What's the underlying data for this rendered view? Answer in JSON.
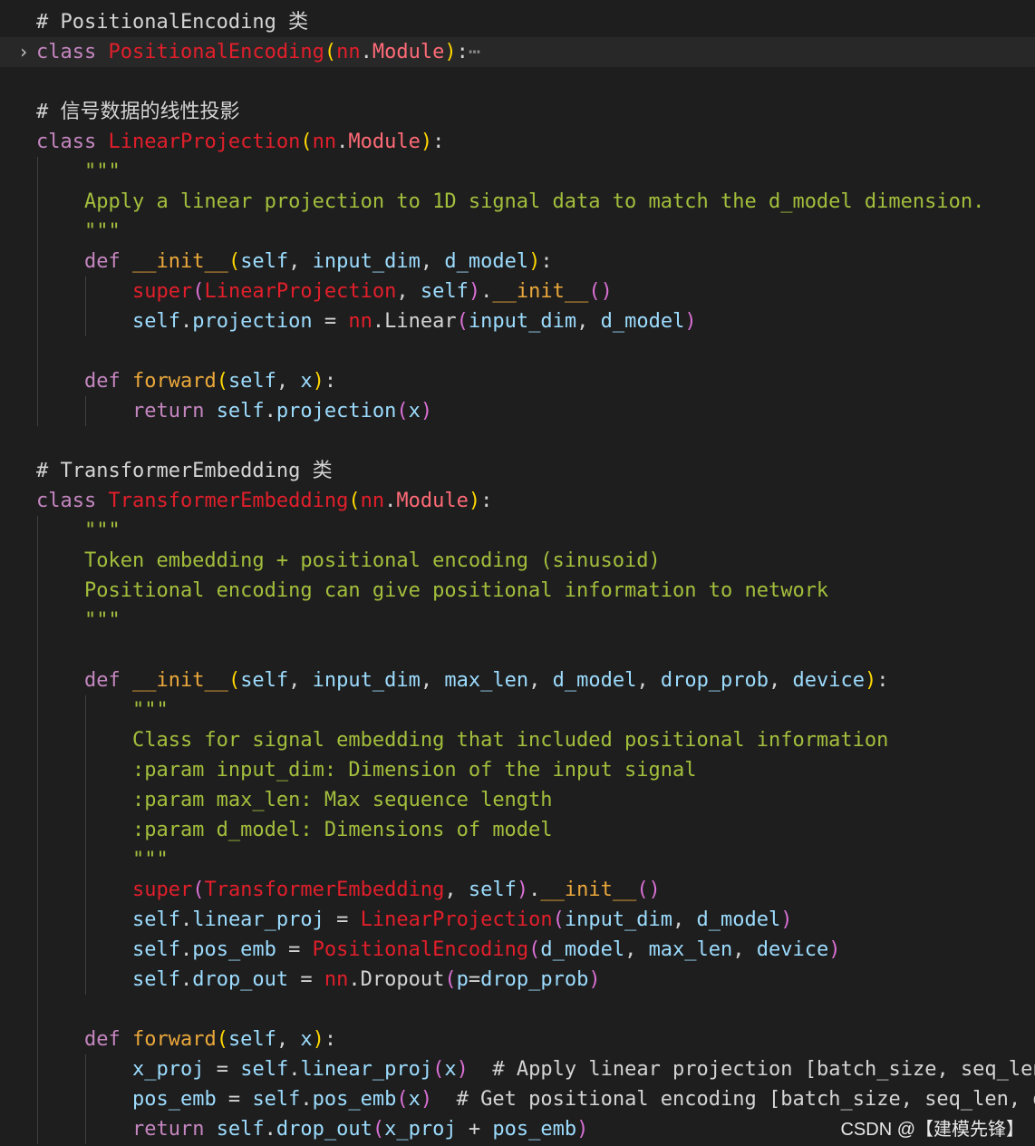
{
  "lines": [
    {
      "current": false,
      "fold": "",
      "tokens": [
        {
          "t": "# PositionalEncoding 类",
          "c": "cm"
        }
      ]
    },
    {
      "current": true,
      "fold": "›",
      "tokens": [
        {
          "t": "class ",
          "c": "kw"
        },
        {
          "t": "PositionalEncoding",
          "c": "cls"
        },
        {
          "t": "(",
          "c": "p0"
        },
        {
          "t": "nn",
          "c": "mod"
        },
        {
          "t": ".",
          "c": "plain"
        },
        {
          "t": "Module",
          "c": "modclass"
        },
        {
          "t": ")",
          "c": "p0"
        },
        {
          "t": ":",
          "c": "plain"
        },
        {
          "t": "⋯",
          "c": "dim"
        }
      ]
    },
    {
      "current": false,
      "fold": "",
      "tokens": []
    },
    {
      "current": false,
      "fold": "",
      "tokens": [
        {
          "t": "# 信号数据的线性投影",
          "c": "cm"
        }
      ]
    },
    {
      "current": false,
      "fold": "",
      "tokens": [
        {
          "t": "class ",
          "c": "kw"
        },
        {
          "t": "LinearProjection",
          "c": "cls"
        },
        {
          "t": "(",
          "c": "p0"
        },
        {
          "t": "nn",
          "c": "mod"
        },
        {
          "t": ".",
          "c": "plain"
        },
        {
          "t": "Module",
          "c": "modclass"
        },
        {
          "t": ")",
          "c": "p0"
        },
        {
          "t": ":",
          "c": "plain"
        }
      ]
    },
    {
      "current": false,
      "fold": "",
      "tokens": [
        {
          "t": "    \"\"\"",
          "c": "doc"
        }
      ]
    },
    {
      "current": false,
      "fold": "",
      "tokens": [
        {
          "t": "    Apply a linear projection to 1D signal data to match the d_model dimension.",
          "c": "doc"
        }
      ]
    },
    {
      "current": false,
      "fold": "",
      "tokens": [
        {
          "t": "    \"\"\"",
          "c": "doc"
        }
      ]
    },
    {
      "current": false,
      "fold": "",
      "tokens": [
        {
          "t": "    ",
          "c": "plain"
        },
        {
          "t": "def ",
          "c": "kw"
        },
        {
          "t": "__init__",
          "c": "fn"
        },
        {
          "t": "(",
          "c": "p0"
        },
        {
          "t": "self",
          "c": "self"
        },
        {
          "t": ", ",
          "c": "plain"
        },
        {
          "t": "input_dim",
          "c": "attr"
        },
        {
          "t": ", ",
          "c": "plain"
        },
        {
          "t": "d_model",
          "c": "attr"
        },
        {
          "t": ")",
          "c": "p0"
        },
        {
          "t": ":",
          "c": "plain"
        }
      ]
    },
    {
      "current": false,
      "fold": "",
      "tokens": [
        {
          "t": "        ",
          "c": "plain"
        },
        {
          "t": "super",
          "c": "cls"
        },
        {
          "t": "(",
          "c": "p1"
        },
        {
          "t": "LinearProjection",
          "c": "cls"
        },
        {
          "t": ", ",
          "c": "plain"
        },
        {
          "t": "self",
          "c": "self"
        },
        {
          "t": ")",
          "c": "p1"
        },
        {
          "t": ".",
          "c": "plain"
        },
        {
          "t": "__init__",
          "c": "fn"
        },
        {
          "t": "()",
          "c": "p1"
        }
      ]
    },
    {
      "current": false,
      "fold": "",
      "tokens": [
        {
          "t": "        ",
          "c": "plain"
        },
        {
          "t": "self",
          "c": "self"
        },
        {
          "t": ".",
          "c": "plain"
        },
        {
          "t": "projection",
          "c": "attr"
        },
        {
          "t": " = ",
          "c": "op"
        },
        {
          "t": "nn",
          "c": "mod"
        },
        {
          "t": ".",
          "c": "plain"
        },
        {
          "t": "Linear",
          "c": "plain"
        },
        {
          "t": "(",
          "c": "p1"
        },
        {
          "t": "input_dim",
          "c": "attr"
        },
        {
          "t": ", ",
          "c": "plain"
        },
        {
          "t": "d_model",
          "c": "attr"
        },
        {
          "t": ")",
          "c": "p1"
        }
      ]
    },
    {
      "current": false,
      "fold": "",
      "tokens": []
    },
    {
      "current": false,
      "fold": "",
      "tokens": [
        {
          "t": "    ",
          "c": "plain"
        },
        {
          "t": "def ",
          "c": "kw"
        },
        {
          "t": "forward",
          "c": "fn"
        },
        {
          "t": "(",
          "c": "p0"
        },
        {
          "t": "self",
          "c": "self"
        },
        {
          "t": ", ",
          "c": "plain"
        },
        {
          "t": "x",
          "c": "attr"
        },
        {
          "t": ")",
          "c": "p0"
        },
        {
          "t": ":",
          "c": "plain"
        }
      ]
    },
    {
      "current": false,
      "fold": "",
      "tokens": [
        {
          "t": "        ",
          "c": "plain"
        },
        {
          "t": "return ",
          "c": "kw"
        },
        {
          "t": "self",
          "c": "self"
        },
        {
          "t": ".",
          "c": "plain"
        },
        {
          "t": "projection",
          "c": "attr"
        },
        {
          "t": "(",
          "c": "p1"
        },
        {
          "t": "x",
          "c": "attr"
        },
        {
          "t": ")",
          "c": "p1"
        }
      ]
    },
    {
      "current": false,
      "fold": "",
      "tokens": []
    },
    {
      "current": false,
      "fold": "",
      "tokens": [
        {
          "t": "# TransformerEmbedding 类",
          "c": "cm"
        }
      ]
    },
    {
      "current": false,
      "fold": "",
      "tokens": [
        {
          "t": "class ",
          "c": "kw"
        },
        {
          "t": "TransformerEmbedding",
          "c": "cls"
        },
        {
          "t": "(",
          "c": "p0"
        },
        {
          "t": "nn",
          "c": "mod"
        },
        {
          "t": ".",
          "c": "plain"
        },
        {
          "t": "Module",
          "c": "modclass"
        },
        {
          "t": ")",
          "c": "p0"
        },
        {
          "t": ":",
          "c": "plain"
        }
      ]
    },
    {
      "current": false,
      "fold": "",
      "tokens": [
        {
          "t": "    \"\"\"",
          "c": "doc"
        }
      ]
    },
    {
      "current": false,
      "fold": "",
      "tokens": [
        {
          "t": "    Token embedding + positional encoding (sinusoid)",
          "c": "doc"
        }
      ]
    },
    {
      "current": false,
      "fold": "",
      "tokens": [
        {
          "t": "    Positional encoding can give positional information to network",
          "c": "doc"
        }
      ]
    },
    {
      "current": false,
      "fold": "",
      "tokens": [
        {
          "t": "    \"\"\"",
          "c": "doc"
        }
      ]
    },
    {
      "current": false,
      "fold": "",
      "tokens": []
    },
    {
      "current": false,
      "fold": "",
      "tokens": [
        {
          "t": "    ",
          "c": "plain"
        },
        {
          "t": "def ",
          "c": "kw"
        },
        {
          "t": "__init__",
          "c": "fn"
        },
        {
          "t": "(",
          "c": "p0"
        },
        {
          "t": "self",
          "c": "self"
        },
        {
          "t": ", ",
          "c": "plain"
        },
        {
          "t": "input_dim",
          "c": "attr"
        },
        {
          "t": ", ",
          "c": "plain"
        },
        {
          "t": "max_len",
          "c": "attr"
        },
        {
          "t": ", ",
          "c": "plain"
        },
        {
          "t": "d_model",
          "c": "attr"
        },
        {
          "t": ", ",
          "c": "plain"
        },
        {
          "t": "drop_prob",
          "c": "attr"
        },
        {
          "t": ", ",
          "c": "plain"
        },
        {
          "t": "device",
          "c": "attr"
        },
        {
          "t": ")",
          "c": "p0"
        },
        {
          "t": ":",
          "c": "plain"
        }
      ]
    },
    {
      "current": false,
      "fold": "",
      "tokens": [
        {
          "t": "        \"\"\"",
          "c": "doc"
        }
      ]
    },
    {
      "current": false,
      "fold": "",
      "tokens": [
        {
          "t": "        Class for signal embedding that included positional information",
          "c": "doc"
        }
      ]
    },
    {
      "current": false,
      "fold": "",
      "tokens": [
        {
          "t": "        :param input_dim: Dimension of the input signal",
          "c": "doc"
        }
      ]
    },
    {
      "current": false,
      "fold": "",
      "tokens": [
        {
          "t": "        :param max_len: Max sequence length",
          "c": "doc"
        }
      ]
    },
    {
      "current": false,
      "fold": "",
      "tokens": [
        {
          "t": "        :param d_model: Dimensions of model",
          "c": "doc"
        }
      ]
    },
    {
      "current": false,
      "fold": "",
      "tokens": [
        {
          "t": "        \"\"\"",
          "c": "doc"
        }
      ]
    },
    {
      "current": false,
      "fold": "",
      "tokens": [
        {
          "t": "        ",
          "c": "plain"
        },
        {
          "t": "super",
          "c": "cls"
        },
        {
          "t": "(",
          "c": "p1"
        },
        {
          "t": "TransformerEmbedding",
          "c": "cls"
        },
        {
          "t": ", ",
          "c": "plain"
        },
        {
          "t": "self",
          "c": "self"
        },
        {
          "t": ")",
          "c": "p1"
        },
        {
          "t": ".",
          "c": "plain"
        },
        {
          "t": "__init__",
          "c": "fn"
        },
        {
          "t": "()",
          "c": "p1"
        }
      ]
    },
    {
      "current": false,
      "fold": "",
      "tokens": [
        {
          "t": "        ",
          "c": "plain"
        },
        {
          "t": "self",
          "c": "self"
        },
        {
          "t": ".",
          "c": "plain"
        },
        {
          "t": "linear_proj",
          "c": "attr"
        },
        {
          "t": " = ",
          "c": "op"
        },
        {
          "t": "LinearProjection",
          "c": "cls"
        },
        {
          "t": "(",
          "c": "p1"
        },
        {
          "t": "input_dim",
          "c": "attr"
        },
        {
          "t": ", ",
          "c": "plain"
        },
        {
          "t": "d_model",
          "c": "attr"
        },
        {
          "t": ")",
          "c": "p1"
        }
      ]
    },
    {
      "current": false,
      "fold": "",
      "tokens": [
        {
          "t": "        ",
          "c": "plain"
        },
        {
          "t": "self",
          "c": "self"
        },
        {
          "t": ".",
          "c": "plain"
        },
        {
          "t": "pos_emb",
          "c": "attr"
        },
        {
          "t": " = ",
          "c": "op"
        },
        {
          "t": "PositionalEncoding",
          "c": "cls"
        },
        {
          "t": "(",
          "c": "p1"
        },
        {
          "t": "d_model",
          "c": "attr"
        },
        {
          "t": ", ",
          "c": "plain"
        },
        {
          "t": "max_len",
          "c": "attr"
        },
        {
          "t": ", ",
          "c": "plain"
        },
        {
          "t": "device",
          "c": "attr"
        },
        {
          "t": ")",
          "c": "p1"
        }
      ]
    },
    {
      "current": false,
      "fold": "",
      "tokens": [
        {
          "t": "        ",
          "c": "plain"
        },
        {
          "t": "self",
          "c": "self"
        },
        {
          "t": ".",
          "c": "plain"
        },
        {
          "t": "drop_out",
          "c": "attr"
        },
        {
          "t": " = ",
          "c": "op"
        },
        {
          "t": "nn",
          "c": "mod"
        },
        {
          "t": ".",
          "c": "plain"
        },
        {
          "t": "Dropout",
          "c": "plain"
        },
        {
          "t": "(",
          "c": "p1"
        },
        {
          "t": "p",
          "c": "attr"
        },
        {
          "t": "=",
          "c": "op"
        },
        {
          "t": "drop_prob",
          "c": "attr"
        },
        {
          "t": ")",
          "c": "p1"
        }
      ]
    },
    {
      "current": false,
      "fold": "",
      "tokens": []
    },
    {
      "current": false,
      "fold": "",
      "tokens": [
        {
          "t": "    ",
          "c": "plain"
        },
        {
          "t": "def ",
          "c": "kw"
        },
        {
          "t": "forward",
          "c": "fn"
        },
        {
          "t": "(",
          "c": "p0"
        },
        {
          "t": "self",
          "c": "self"
        },
        {
          "t": ", ",
          "c": "plain"
        },
        {
          "t": "x",
          "c": "attr"
        },
        {
          "t": ")",
          "c": "p0"
        },
        {
          "t": ":",
          "c": "plain"
        }
      ]
    },
    {
      "current": false,
      "fold": "",
      "tokens": [
        {
          "t": "        ",
          "c": "plain"
        },
        {
          "t": "x_proj",
          "c": "attr"
        },
        {
          "t": " = ",
          "c": "op"
        },
        {
          "t": "self",
          "c": "self"
        },
        {
          "t": ".",
          "c": "plain"
        },
        {
          "t": "linear_proj",
          "c": "attr"
        },
        {
          "t": "(",
          "c": "p1"
        },
        {
          "t": "x",
          "c": "attr"
        },
        {
          "t": ")",
          "c": "p1"
        },
        {
          "t": "  # Apply linear projection [batch_size, seq_len",
          "c": "cm"
        }
      ]
    },
    {
      "current": false,
      "fold": "",
      "tokens": [
        {
          "t": "        ",
          "c": "plain"
        },
        {
          "t": "pos_emb",
          "c": "attr"
        },
        {
          "t": " = ",
          "c": "op"
        },
        {
          "t": "self",
          "c": "self"
        },
        {
          "t": ".",
          "c": "plain"
        },
        {
          "t": "pos_emb",
          "c": "attr"
        },
        {
          "t": "(",
          "c": "p1"
        },
        {
          "t": "x",
          "c": "attr"
        },
        {
          "t": ")",
          "c": "p1"
        },
        {
          "t": "  # Get positional encoding [batch_size, seq_len, d",
          "c": "cm"
        }
      ]
    },
    {
      "current": false,
      "fold": "",
      "tokens": [
        {
          "t": "        ",
          "c": "plain"
        },
        {
          "t": "return ",
          "c": "kw"
        },
        {
          "t": "self",
          "c": "self"
        },
        {
          "t": ".",
          "c": "plain"
        },
        {
          "t": "drop_out",
          "c": "attr"
        },
        {
          "t": "(",
          "c": "p1"
        },
        {
          "t": "x_proj",
          "c": "attr"
        },
        {
          "t": " + ",
          "c": "op"
        },
        {
          "t": "pos_emb",
          "c": "attr"
        },
        {
          "t": ")",
          "c": "p1"
        }
      ]
    }
  ],
  "watermark": "CSDN @【建模先锋】",
  "colors": {
    "background": "#1e1e1e",
    "keyword": "#c586c0",
    "class_name": "#e21f2b",
    "docstring": "#a3bf3c",
    "function": "#eba83b",
    "variable": "#9cdcfe",
    "bracket_1": "#ffd700",
    "bracket_2": "#da70d6"
  }
}
